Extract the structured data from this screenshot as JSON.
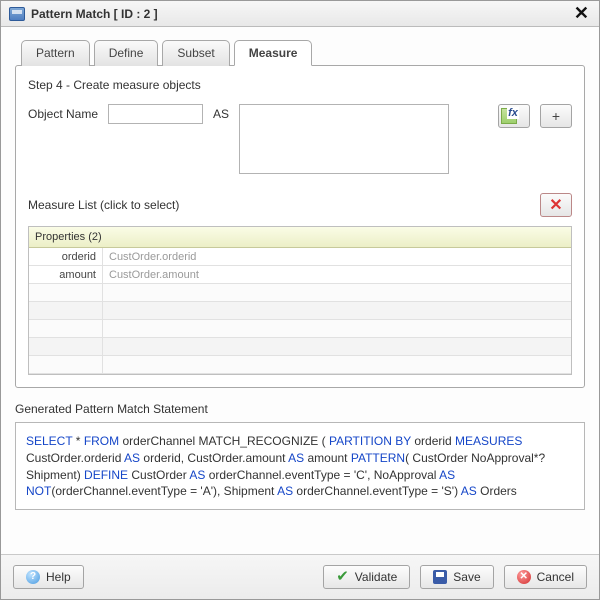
{
  "window": {
    "title": "Pattern Match [ ID : 2 ]",
    "close_glyph": "✕"
  },
  "tabs": [
    {
      "label": "Pattern"
    },
    {
      "label": "Define"
    },
    {
      "label": "Subset"
    },
    {
      "label": "Measure"
    }
  ],
  "measure": {
    "step_label": "Step 4 - Create measure objects",
    "object_name_label": "Object Name",
    "object_name_value": "",
    "as_label": "AS",
    "as_value": "",
    "measure_list_label": "Measure List (click to select)",
    "properties_header": "Properties (2)",
    "rows": [
      {
        "name": "orderid",
        "value": "CustOrder.orderid"
      },
      {
        "name": "amount",
        "value": "CustOrder.amount"
      }
    ]
  },
  "generated": {
    "label": "Generated Pattern Match Statement",
    "tokens": [
      {
        "t": "SELECT",
        "k": true
      },
      {
        "t": " * "
      },
      {
        "t": "FROM",
        "k": true
      },
      {
        "t": " orderChannel  MATCH_RECOGNIZE ( "
      },
      {
        "t": "PARTITION BY",
        "k": true
      },
      {
        "t": " orderid "
      },
      {
        "t": "MEASURES",
        "k": true
      },
      {
        "t": " CustOrder.orderid "
      },
      {
        "t": "AS",
        "k": true
      },
      {
        "t": " orderid, CustOrder.amount "
      },
      {
        "t": "AS",
        "k": true
      },
      {
        "t": " amount "
      },
      {
        "t": "PATTERN",
        "k": true
      },
      {
        "t": "( CustOrder NoApproval*? Shipment) "
      },
      {
        "t": "DEFINE",
        "k": true
      },
      {
        "t": " CustOrder "
      },
      {
        "t": "AS",
        "k": true
      },
      {
        "t": " orderChannel.eventType = 'C', NoApproval "
      },
      {
        "t": "AS",
        "k": true
      },
      {
        "t": " "
      },
      {
        "t": "NOT",
        "k": true
      },
      {
        "t": "(orderChannel.eventType = 'A'), Shipment "
      },
      {
        "t": "AS",
        "k": true
      },
      {
        "t": " orderChannel.eventType = 'S') "
      },
      {
        "t": "AS",
        "k": true
      },
      {
        "t": " Orders"
      }
    ]
  },
  "footer": {
    "help": "Help",
    "validate": "Validate",
    "save": "Save",
    "cancel": "Cancel"
  },
  "icons": {
    "add": "+",
    "delete": "✕",
    "help_glyph": "?",
    "check_glyph": "✔",
    "cancel_glyph": "✕",
    "fx_glyph": "fx"
  }
}
